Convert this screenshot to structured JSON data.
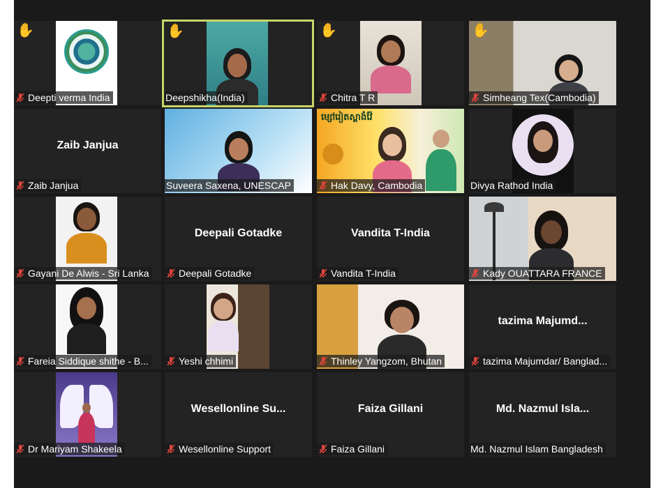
{
  "meeting": {
    "participants": [
      {
        "name": "Deepti verma India",
        "muted": true,
        "hand_raised": true,
        "video": true
      },
      {
        "name": "Deepshikha(India)",
        "muted": false,
        "hand_raised": true,
        "video": true,
        "active_speaker": true
      },
      {
        "name": "Chitra T R",
        "muted": true,
        "hand_raised": true,
        "video": true
      },
      {
        "name": "Simheang Tex(Cambodia)",
        "muted": true,
        "hand_raised": true,
        "video": true
      },
      {
        "name": "Zaib Janjua",
        "muted": true,
        "hand_raised": false,
        "video": false,
        "card_name": "Zaib Janjua"
      },
      {
        "name": "Suveera Saxena, UNESCAP",
        "muted": false,
        "hand_raised": false,
        "video": true
      },
      {
        "name": "Hak Davy, Cambodia",
        "muted": true,
        "hand_raised": false,
        "video": true,
        "banner_text": "ម្សៅរៀតស្ពាងំវ៉ែ"
      },
      {
        "name": "Divya Rathod India",
        "muted": false,
        "hand_raised": false,
        "video": true
      },
      {
        "name": "Gayani De Alwis - Sri Lanka",
        "muted": true,
        "hand_raised": false,
        "video": true
      },
      {
        "name": "Deepali Gotadke",
        "muted": true,
        "hand_raised": false,
        "video": false,
        "card_name": "Deepali Gotadke"
      },
      {
        "name": "Vandita T-India",
        "muted": true,
        "hand_raised": false,
        "video": false,
        "card_name": "Vandita T-India"
      },
      {
        "name": "Kady OUATTARA FRANCE",
        "muted": true,
        "hand_raised": false,
        "video": true
      },
      {
        "name": "Fareia Siddique shithe  - B...",
        "muted": true,
        "hand_raised": false,
        "video": true
      },
      {
        "name": "Yeshi chhimi",
        "muted": true,
        "hand_raised": false,
        "video": true
      },
      {
        "name": "Thinley Yangzom, Bhutan",
        "muted": true,
        "hand_raised": false,
        "video": true
      },
      {
        "name": "tazima Majumdar/ Banglad...",
        "muted": true,
        "hand_raised": false,
        "video": false,
        "card_name": "tazima  Majumd..."
      },
      {
        "name": "Dr Mariyam Shakeela",
        "muted": true,
        "hand_raised": false,
        "video": true
      },
      {
        "name": "Wesellonline Support",
        "muted": true,
        "hand_raised": false,
        "video": false,
        "card_name": "Wesellonline  Su..."
      },
      {
        "name": "Faiza Gillani",
        "muted": true,
        "hand_raised": false,
        "video": false,
        "card_name": "Faiza Gillani"
      },
      {
        "name": "Md. Nazmul Islam Bangladesh",
        "muted": false,
        "hand_raised": false,
        "video": false,
        "card_name": "Md.  Nazmul  Isla..."
      }
    ]
  },
  "colors": {
    "background": "#1a1a1a",
    "tile": "#232323",
    "active_border": "#c8d66a",
    "muted_icon": "#e0453a",
    "raised_hand": "#f4c542"
  }
}
